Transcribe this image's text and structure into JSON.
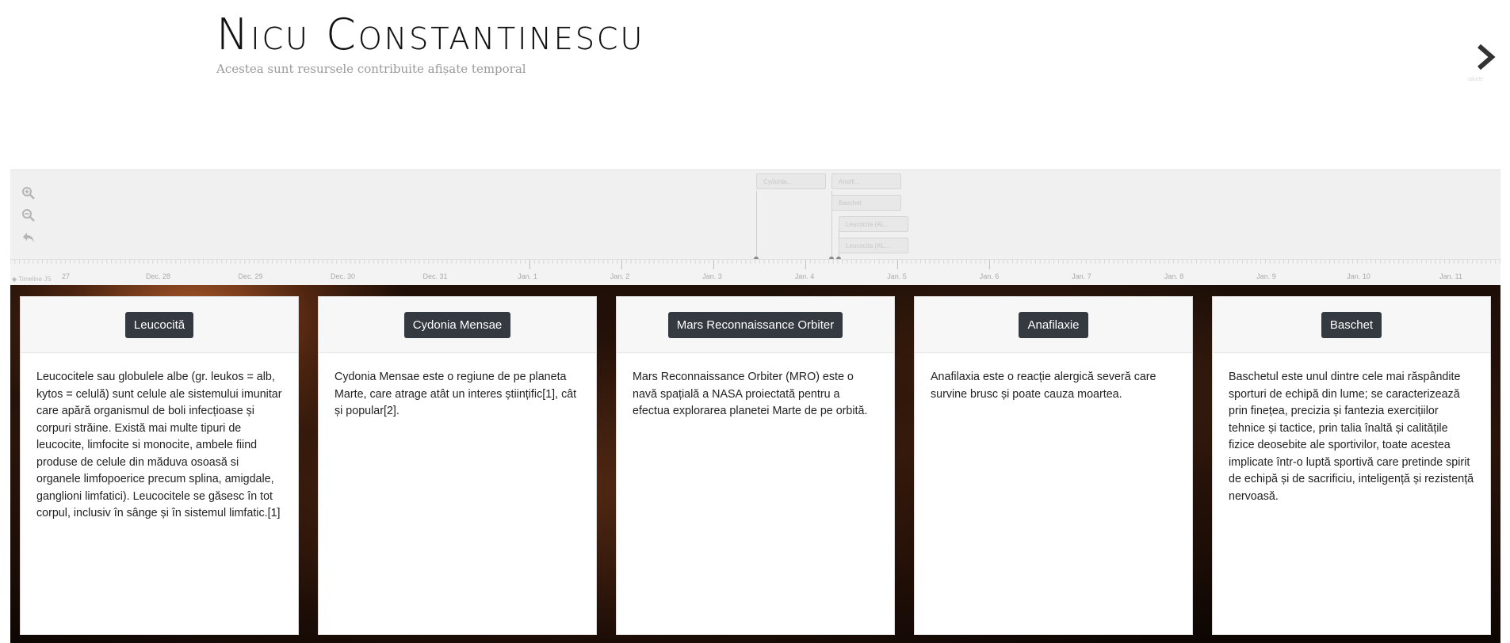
{
  "header": {
    "title": "Nicu Constantinescu",
    "subtitle": "Acestea sunt resursele contribuite afișate temporal"
  },
  "nav": {
    "next_icon": "chevron-right-icon",
    "next_hint": "tabele"
  },
  "timeline": {
    "controls": [
      {
        "name": "zoom-in",
        "icon": "zoom-in-icon"
      },
      {
        "name": "zoom-out",
        "icon": "zoom-out-icon"
      },
      {
        "name": "back",
        "icon": "undo-icon"
      }
    ],
    "markers": [
      {
        "label": "Cydonia..."
      },
      {
        "label": "Anafil..."
      },
      {
        "label": "Baschet"
      },
      {
        "label": "Leucocita (AL..."
      },
      {
        "label": "Leucocita (AL..."
      }
    ],
    "dates": [
      "27",
      "Dec. 28",
      "Dec. 29",
      "Dec. 30",
      "Dec. 31",
      "Jan. 1",
      "Jan. 2",
      "Jan. 3",
      "Jan. 4",
      "Jan. 5",
      "Jan. 6",
      "Jan. 7",
      "Jan. 8",
      "Jan. 9",
      "Jan. 10",
      "Jan. 11"
    ],
    "credit": "Timeline JS"
  },
  "cards": [
    {
      "button": "Leucocită",
      "text": "Leucocitele sau globulele albe (gr. leukos = alb, kytos = celulă) sunt celule ale sistemului imunitar care apără organismul de boli infecțioase și corpuri străine. Există mai multe tipuri de leucocite, limfocite si monocite, ambele fiind produse de celule din măduva osoasă si organele limfopoerice precum splina, amigdale, ganglioni limfatici). Leucocitele se găsesc în tot corpul, inclusiv în sânge și în sistemul limfatic.[1]"
    },
    {
      "button": "Cydonia Mensae",
      "text": "Cydonia Mensae este o regiune de pe planeta Marte, care atrage atât un interes științific[1], cât și popular[2]."
    },
    {
      "button": "Mars Reconnaissance Orbiter",
      "text": "Mars Reconnaissance Orbiter (MRO) este o navă spațială a NASA proiectată pentru a efectua explorarea planetei Marte de pe orbită."
    },
    {
      "button": "Anafilaxie",
      "text": "Anafilaxia este o reacție alergică severă care survine brusc și poate cauza moartea."
    },
    {
      "button": "Baschet",
      "text": "Baschetul este unul dintre cele mai răspândite sporturi de echipă din lume; se caracterizează prin finețea, precizia și fantezia exercițiilor tehnice și tactice, prin talia înaltă și calitățile fizice deosebite ale sportivilor, toate acestea implicate într-o luptă sportivă care pretinde spirit de echipă și de sacrificiu, inteligență și rezistență nervoasă."
    }
  ]
}
